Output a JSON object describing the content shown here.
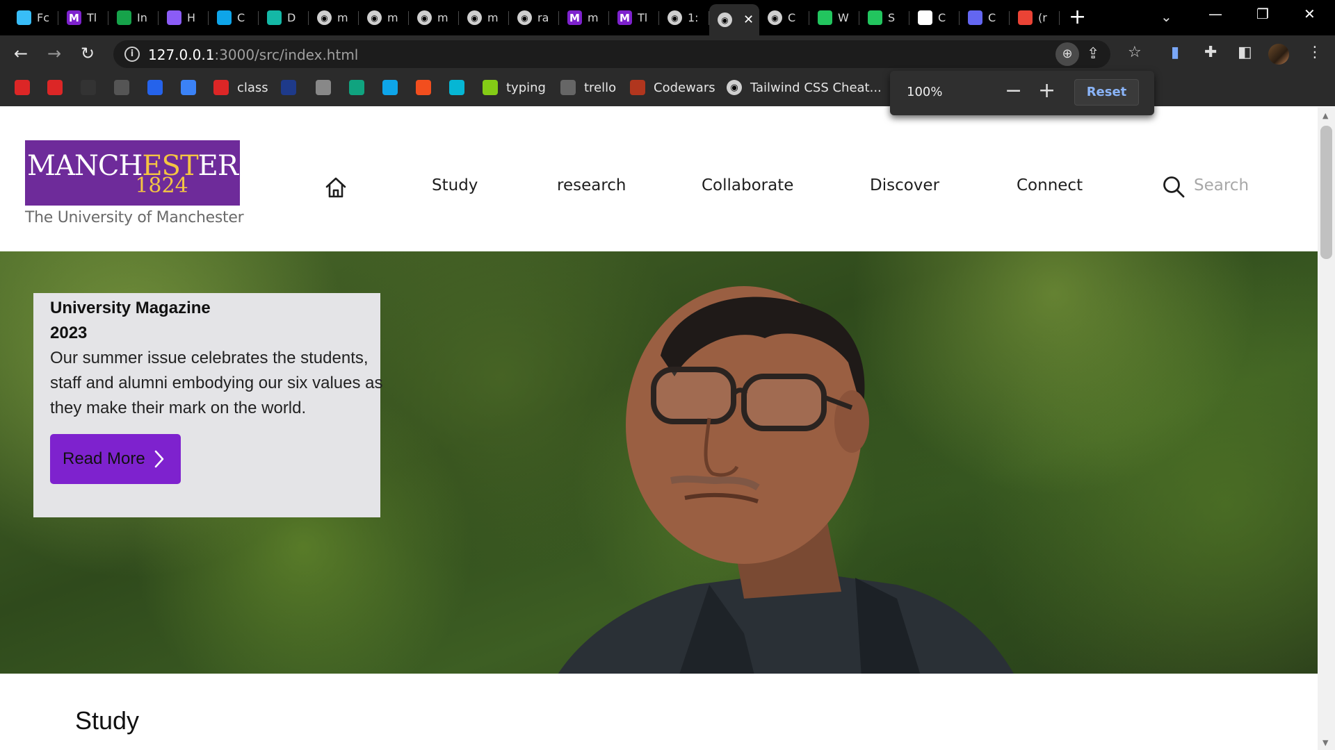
{
  "browser": {
    "tabs": [
      {
        "icon": "tailwind-icon",
        "label": "Fc",
        "color": "#38bdf8"
      },
      {
        "icon": "m-icon",
        "label": "Tl",
        "color": "#7e22ce"
      },
      {
        "icon": "sheets-icon",
        "label": "In",
        "color": "#16a34a"
      },
      {
        "icon": "shield-icon",
        "label": "H",
        "color": "#8b5cf6"
      },
      {
        "icon": "cloud-icon",
        "label": "C",
        "color": "#0ea5e9"
      },
      {
        "icon": "drive-icon",
        "label": "D",
        "color": "#14b8a6"
      },
      {
        "icon": "globe-icon",
        "label": "m",
        "color": "#cfcfcf"
      },
      {
        "icon": "globe-icon",
        "label": "m",
        "color": "#cfcfcf"
      },
      {
        "icon": "globe-icon",
        "label": "m",
        "color": "#cfcfcf"
      },
      {
        "icon": "globe-icon",
        "label": "m",
        "color": "#cfcfcf"
      },
      {
        "icon": "globe-icon",
        "label": "ra",
        "color": "#cfcfcf"
      },
      {
        "icon": "m-icon",
        "label": "m",
        "color": "#7e22ce"
      },
      {
        "icon": "m-icon",
        "label": "Tl",
        "color": "#7e22ce"
      },
      {
        "icon": "globe-icon",
        "label": "1:",
        "color": "#cfcfcf"
      },
      {
        "icon": "globe-icon",
        "label": "",
        "color": "#cfcfcf",
        "active": true
      },
      {
        "icon": "globe-icon",
        "label": "C",
        "color": "#cfcfcf"
      },
      {
        "icon": "w-icon",
        "label": "W",
        "color": "#22c55e"
      },
      {
        "icon": "v-icon",
        "label": "S",
        "color": "#22c55e"
      },
      {
        "icon": "github-icon",
        "label": "C",
        "color": "#ffffff"
      },
      {
        "icon": "list-icon",
        "label": "C",
        "color": "#6366f1"
      },
      {
        "icon": "gmail-icon",
        "label": "(r",
        "color": "#ea4335"
      }
    ],
    "url_host": "127.0.0.1",
    "url_path": ":3000/src/index.html",
    "bookmarks": [
      {
        "icon": "adobe-icon",
        "label": "",
        "color": "#dc2626"
      },
      {
        "icon": "pdf-icon",
        "label": "",
        "color": "#dc2626"
      },
      {
        "icon": "github-icon",
        "label": "",
        "color": "#333"
      },
      {
        "icon": "drone-icon",
        "label": "",
        "color": "#555"
      },
      {
        "icon": "c-icon",
        "label": "",
        "color": "#2563eb"
      },
      {
        "icon": "cloud-icon",
        "label": "",
        "color": "#3b82f6"
      },
      {
        "icon": "class-icon",
        "label": "class",
        "color": "#dc2626"
      },
      {
        "icon": "dots-icon",
        "label": "",
        "color": "#1e3a8a"
      },
      {
        "icon": "cloud-icon",
        "label": "",
        "color": "#888"
      },
      {
        "icon": "chatgpt-icon",
        "label": "",
        "color": "#10a37f"
      },
      {
        "icon": "salesforce-icon",
        "label": "",
        "color": "#0ea5e9"
      },
      {
        "icon": "figma-icon",
        "label": "",
        "color": "#f24e1e"
      },
      {
        "icon": "diamond-icon",
        "label": "",
        "color": "#06b6d4"
      },
      {
        "icon": "typing-icon",
        "label": "typing",
        "color": "#84cc16"
      },
      {
        "icon": "trello-icon",
        "label": "trello",
        "color": "#666"
      },
      {
        "icon": "codewars-icon",
        "label": "Codewars",
        "color": "#b1361e"
      },
      {
        "icon": "globe-icon",
        "label": "Tailwind CSS Cheat...",
        "color": "#cfcfcf"
      }
    ],
    "zoom_popup": {
      "level": "100%",
      "minus": "−",
      "plus": "+",
      "reset": "Reset"
    }
  },
  "header": {
    "logo_name_a": "MANCH",
    "logo_name_b": "EST",
    "logo_name_c": "ER",
    "logo_year": "1824",
    "logo_sub": "The University of Manchester",
    "nav": [
      "Study",
      "research",
      "Collaborate",
      "Discover",
      "Connect"
    ],
    "search_placeholder": "Search"
  },
  "hero": {
    "title": "University Magazine 2023",
    "body": "Our summer issue celebrates the students, staff and alumni embodying our six values as they make their mark on the world.",
    "button": "Read More"
  },
  "section": {
    "heading": "Study"
  }
}
